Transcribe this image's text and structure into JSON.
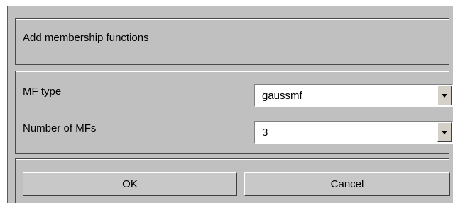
{
  "header": {
    "title": "Add membership functions"
  },
  "options": {
    "mf_type": {
      "label": "MF type",
      "value": "gaussmf"
    },
    "num_mfs": {
      "label": "Number of MFs",
      "value": "3"
    }
  },
  "buttons": {
    "ok": "OK",
    "cancel": "Cancel"
  },
  "icons": {
    "dropdown_arrow": "chevron-down-icon"
  }
}
